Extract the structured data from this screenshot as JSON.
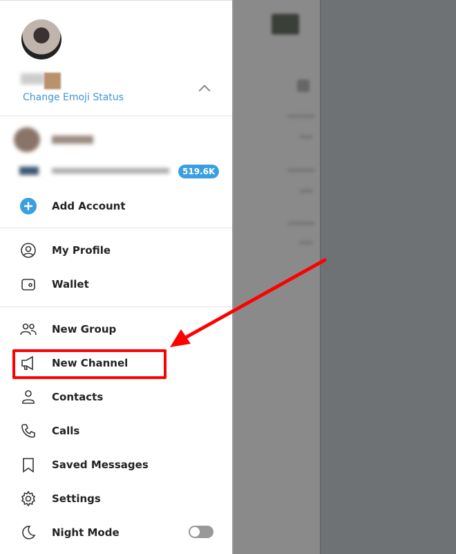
{
  "profile": {
    "change_emoji_status": "Change Emoji Status"
  },
  "accounts": [
    {
      "name_blurred": true
    },
    {
      "name_blurred": true,
      "badge": "519.6K"
    }
  ],
  "add_account": "Add Account",
  "menu": [
    {
      "label": "My Profile",
      "icon": "user-circle-icon"
    },
    {
      "label": "Wallet",
      "icon": "wallet-icon"
    },
    {
      "label": "New Group",
      "icon": "group-icon"
    },
    {
      "label": "New Channel",
      "icon": "megaphone-icon",
      "highlighted": true
    },
    {
      "label": "Contacts",
      "icon": "user-icon"
    },
    {
      "label": "Calls",
      "icon": "phone-icon"
    },
    {
      "label": "Saved Messages",
      "icon": "bookmark-icon"
    },
    {
      "label": "Settings",
      "icon": "gear-icon"
    },
    {
      "label": "Night Mode",
      "icon": "moon-icon",
      "toggle": false
    }
  ],
  "colors": {
    "accent": "#3a9fe0",
    "annotation": "#ff0000"
  }
}
